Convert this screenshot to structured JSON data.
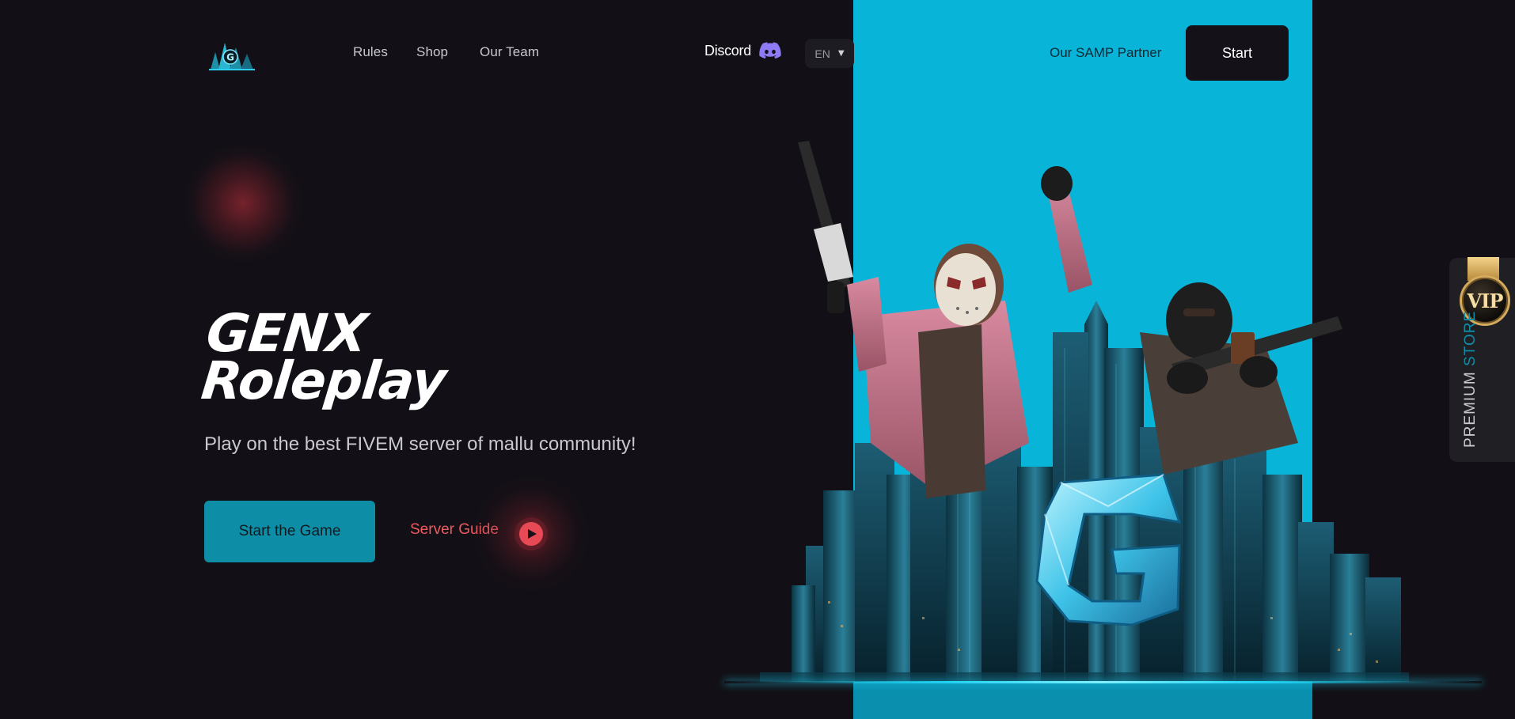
{
  "nav": {
    "logo_letter": "G",
    "links": [
      "Rules",
      "Shop",
      "Our Team"
    ],
    "discord_label": "Discord",
    "discord_icon": "discord-icon",
    "language": "EN",
    "partner_label": "Our SAMP Partner",
    "start_label": "Start"
  },
  "hero": {
    "title_line1": "GENX",
    "title_line2": "Roleplay",
    "subtitle": "Play on the best FIVEM server of mallu community!",
    "start_game_label": "Start the Game",
    "server_guide_label": "Server Guide",
    "play_icon": "play-icon",
    "panel_color": "#08b4d8",
    "art_letter": "G"
  },
  "vip_tab": {
    "badge_text": "VIP",
    "premium_label": "PREMIUM",
    "store_label": "STORE"
  },
  "colors": {
    "background": "#121016",
    "accent_teal": "#0e8ea6",
    "accent_red": "#ef5a5f",
    "discord_purple": "#8f7af5"
  }
}
